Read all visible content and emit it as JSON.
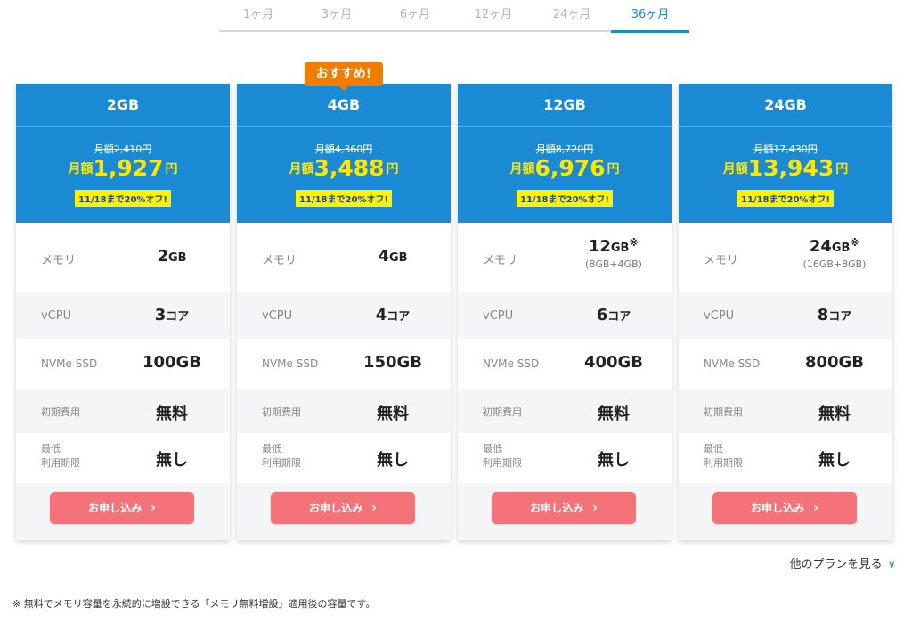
{
  "tabs": [
    {
      "label": "1ヶ月",
      "active": false
    },
    {
      "label": "3ヶ月",
      "active": false
    },
    {
      "label": "6ヶ月",
      "active": false
    },
    {
      "label": "12ヶ月",
      "active": false
    },
    {
      "label": "24ヶ月",
      "active": false
    },
    {
      "label": "36ヶ月",
      "active": true
    }
  ],
  "badge": "おすすめ!",
  "price_prefix": "月額",
  "yen": "円",
  "labels": {
    "memory": "メモリ",
    "vcpu": "vCPU",
    "ssd": "NVMe SSD",
    "initial_fee": "初期費用",
    "min_period_1": "最低",
    "min_period_2": "利用期限"
  },
  "plans": [
    {
      "name": "2GB",
      "old_price": "月額2,410円",
      "price": "1,927",
      "discount": "11/18まで20%オフ!",
      "memory_num": "2",
      "memory_unit": "GB",
      "memory_note": "",
      "memory_sub": "",
      "vcpu_num": "3",
      "vcpu_unit": "コア",
      "ssd": "100GB",
      "initial_fee": "無料",
      "min_period": "無し",
      "apply": "お申し込み"
    },
    {
      "name": "4GB",
      "old_price": "月額4,360円",
      "price": "3,488",
      "discount": "11/18まで20%オフ!",
      "memory_num": "4",
      "memory_unit": "GB",
      "memory_note": "",
      "memory_sub": "",
      "vcpu_num": "4",
      "vcpu_unit": "コア",
      "ssd": "150GB",
      "initial_fee": "無料",
      "min_period": "無し",
      "apply": "お申し込み"
    },
    {
      "name": "12GB",
      "old_price": "月額8,720円",
      "price": "6,976",
      "discount": "11/18まで20%オフ!",
      "memory_num": "12",
      "memory_unit": "GB",
      "memory_note": "※",
      "memory_sub": "(8GB+4GB)",
      "vcpu_num": "6",
      "vcpu_unit": "コア",
      "ssd": "400GB",
      "initial_fee": "無料",
      "min_period": "無し",
      "apply": "お申し込み"
    },
    {
      "name": "24GB",
      "old_price": "月額17,430円",
      "price": "13,943",
      "discount": "11/18まで20%オフ!",
      "memory_num": "24",
      "memory_unit": "GB",
      "memory_note": "※",
      "memory_sub": "(16GB+8GB)",
      "vcpu_num": "8",
      "vcpu_unit": "コア",
      "ssd": "800GB",
      "initial_fee": "無料",
      "min_period": "無し",
      "apply": "お申し込み"
    }
  ],
  "more_plans": "他のプランを見る",
  "footnote": "※ 無料でメモリ容量を永続的に増設できる「メモリ無料増設」適用後の容量です。",
  "colors": {
    "primary": "#1a8ad4",
    "price_highlight": "#ffe600",
    "discount_bg": "#fff200",
    "button": "#f47378",
    "badge": "#f07c00"
  }
}
